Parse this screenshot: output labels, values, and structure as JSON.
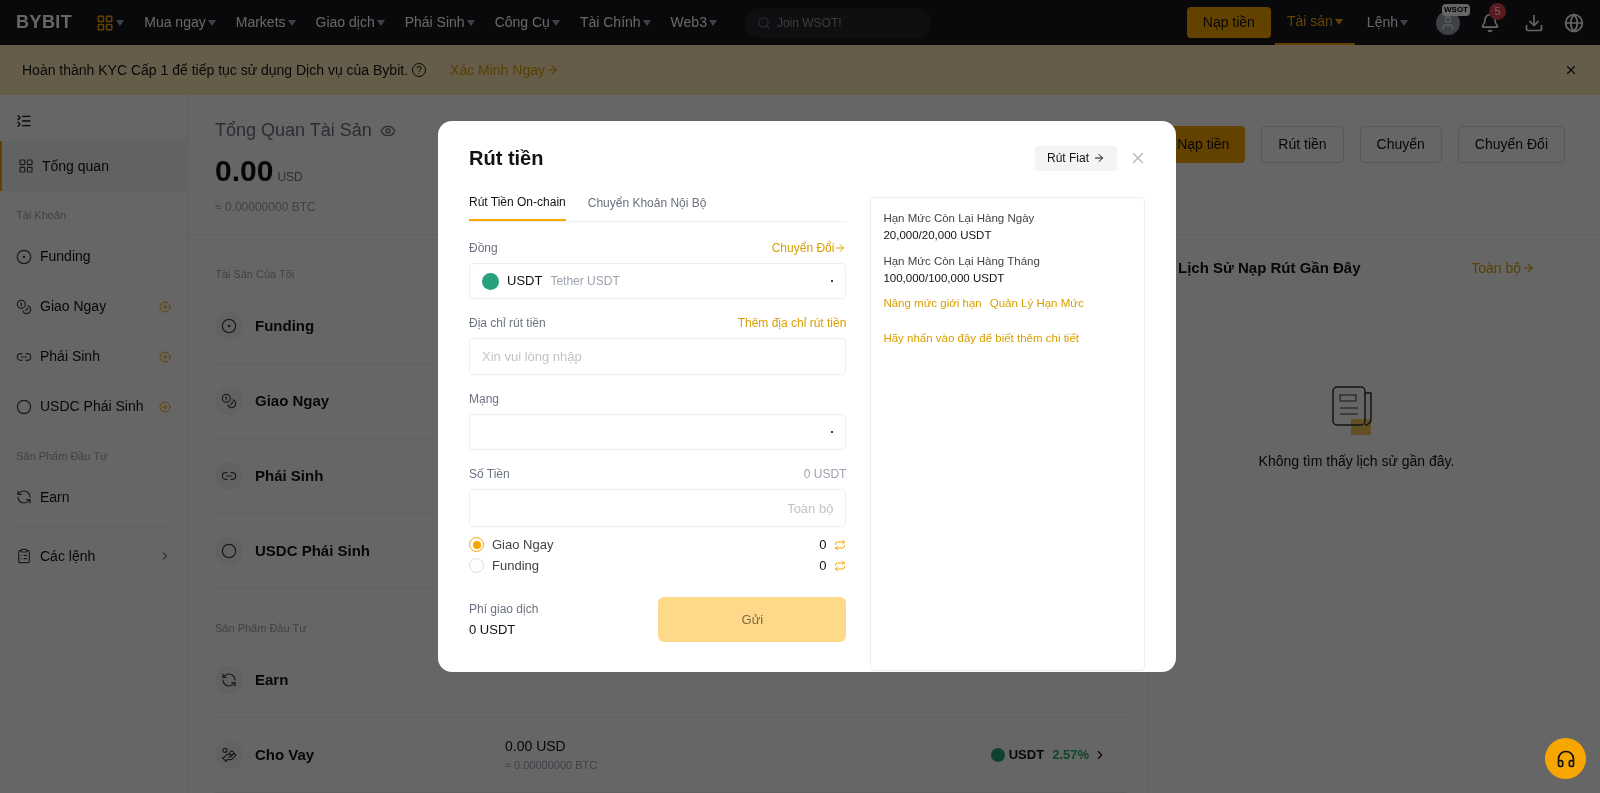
{
  "top_nav": {
    "logo": "BYBIT",
    "menus": [
      {
        "label": "Mua ngay"
      },
      {
        "label": "Markets"
      },
      {
        "label": "Giao dịch"
      },
      {
        "label": "Phái Sinh"
      },
      {
        "label": "Công Cụ"
      },
      {
        "label": "Tài Chính"
      },
      {
        "label": "Web3"
      }
    ],
    "search": {
      "placeholder": "Join WSOT!"
    },
    "deposit_button": "Nạp tiền",
    "right_menus": [
      {
        "label": "Tài sản",
        "selected": true
      },
      {
        "label": "Lệnh",
        "selected": false
      }
    ],
    "avatar_badge": "WSOT",
    "notification_count": "5"
  },
  "banner": {
    "text": "Hoàn thành KYC Cấp 1 để tiếp tục sử dụng Dịch vụ của Bybit.",
    "help": "?",
    "link": "Xác Minh Ngay"
  },
  "sidebar": {
    "items": [
      {
        "kind": "item",
        "label": "Tổng quan",
        "selected": true,
        "addable": false
      },
      {
        "kind": "section",
        "label": "Tài Khoản"
      },
      {
        "kind": "item",
        "label": "Funding",
        "selected": false,
        "addable": false
      },
      {
        "kind": "item",
        "label": "Giao Ngay",
        "selected": false,
        "addable": true
      },
      {
        "kind": "item",
        "label": "Phái Sinh",
        "selected": false,
        "addable": true
      },
      {
        "kind": "item",
        "label": "USDC Phái Sinh",
        "selected": false,
        "addable": true
      },
      {
        "kind": "section",
        "label": "Sản Phẩm Đầu Tư"
      },
      {
        "kind": "item",
        "label": "Earn",
        "selected": false,
        "addable": false
      },
      {
        "kind": "divider"
      },
      {
        "kind": "item",
        "label": "Các lệnh",
        "selected": false,
        "addable": false,
        "chevron": true
      }
    ]
  },
  "overview": {
    "title": "Tổng Quan Tài Sản",
    "amount": "0.00",
    "unit": "USD",
    "btc": "≈ 0.00000000 BTC",
    "buttons": [
      {
        "label": "Nạp tiền",
        "primary": true
      },
      {
        "label": "Rút tiền",
        "primary": false
      },
      {
        "label": "Chuyển",
        "primary": false
      },
      {
        "label": "Chuyển Đổi",
        "primary": false
      }
    ]
  },
  "assets": [
    {
      "kind": "section",
      "label": "Tài Sản Của Tôi"
    },
    {
      "kind": "row",
      "label": "Funding"
    },
    {
      "kind": "row",
      "label": "Giao Ngay"
    },
    {
      "kind": "row",
      "label": "Phái Sinh"
    },
    {
      "kind": "row",
      "label": "USDC Phái Sinh"
    },
    {
      "kind": "section",
      "label": "Sản Phẩm Đầu Tư"
    },
    {
      "kind": "row",
      "label": "Earn"
    },
    {
      "kind": "row",
      "label": "Cho Vay",
      "amount": "0.00 USD",
      "btc": "≈ 0.00000000 BTC",
      "coin": "USDT",
      "rate": "2.57%"
    }
  ],
  "history": {
    "title": "Lịch Sử Nạp Rút Gần Đây",
    "link": "Toàn bộ",
    "empty": "Không tìm thấy lịch sử gần đây."
  },
  "modal": {
    "title": "Rút tiền",
    "fiat_button": "Rút Fiat",
    "tabs": [
      {
        "label": "Rút Tiền On-chain",
        "selected": true
      },
      {
        "label": "Chuyển Khoản Nội Bộ",
        "selected": false
      }
    ],
    "coin": {
      "label": "Đồng",
      "link": "Chuyển Đổi",
      "symbol": "USDT",
      "name": "Tether USDT"
    },
    "address": {
      "label": "Địa chỉ rút tiền",
      "link": "Thêm địa chỉ rút tiền",
      "placeholder": "Xin vui lòng nhập"
    },
    "network": {
      "label": "Mạng"
    },
    "amount": {
      "label": "Số Tiền",
      "balance": "0 USDT",
      "placeholder": "Toàn bộ"
    },
    "sources": [
      {
        "label": "Giao Ngay",
        "value": "0",
        "selected": true
      },
      {
        "label": "Funding",
        "value": "0",
        "selected": false
      }
    ],
    "fee": {
      "label": "Phí giao dịch",
      "value": "0 USDT"
    },
    "submit": "Gửi",
    "limits": [
      {
        "label": "Hạn Mức Còn Lại Hàng Ngày",
        "value": "20,000/20,000 USDT"
      },
      {
        "label": "Hạn Mức Còn Lại Hàng Tháng",
        "value": "100,000/100,000 USDT"
      }
    ],
    "limit_links": [
      "Nâng mức giới hạn",
      "Quản Lý Hạn Mức"
    ],
    "details_link": "Hãy nhấn vào đây để biết thêm chi tiết"
  }
}
